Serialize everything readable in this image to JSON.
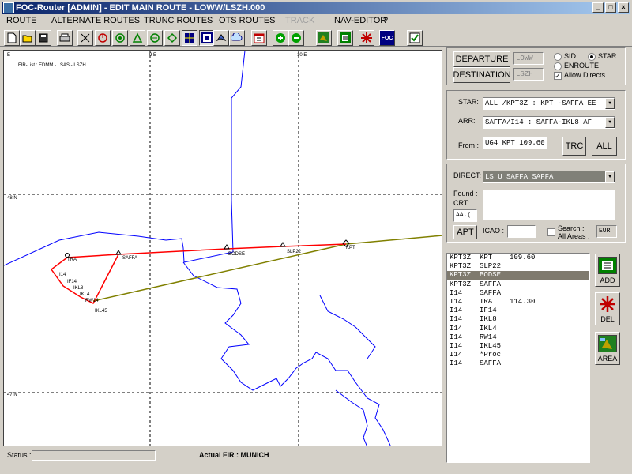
{
  "window": {
    "title": "FOC-Router [ADMIN] - EDIT MAIN ROUTE - LOWW/LSZH.000",
    "controls": [
      "_",
      "□",
      "×"
    ]
  },
  "menu": [
    "ROUTE",
    "ALTERNATE ROUTES",
    "TRUNC ROUTES",
    "OTS ROUTES",
    "TRACK",
    "NAV-EDITOR",
    "?"
  ],
  "toolbar": {
    "icons": [
      "new-icon",
      "open-icon",
      "save-icon",
      "print-icon",
      "measure-icon",
      "compass-icon",
      "target-icon",
      "triangle-icon",
      "navaid-icon",
      "navaid2-icon",
      "grid-icon",
      "zoom-box-icon",
      "plane-icon",
      "cloud-icon",
      "calendar-icon",
      "zoom-in-icon",
      "zoom-out-icon",
      "globe-icon",
      "save-route-icon",
      "redstar-icon",
      "foc-icon",
      "check-icon"
    ],
    "foc_label": "FOC"
  },
  "map": {
    "fir_list": "FIR-List : EDMM - LSAS - LSZH",
    "grid_labels": [
      "E",
      "9 E",
      "10 E",
      "48 N",
      "47 N"
    ],
    "waypoints": [
      "TRA",
      "SAFFA",
      "BODSE",
      "SLP22",
      "KPT",
      "I14",
      "IF14",
      "IKL8",
      "IKL4",
      "IKL45",
      "RW14"
    ],
    "colors": {
      "route": "#ff0000",
      "direct": "#808000",
      "border": "#0000ff",
      "grid": "#000000"
    }
  },
  "status": {
    "label": "Status :",
    "value": "",
    "actual_fir": "Actual FIR : MUNICH"
  },
  "right_panel": {
    "departure_btn": "DEPARTURE",
    "destination_btn": "DESTINATION",
    "departure_value": "LOWW",
    "destination_value": "LSZH",
    "sid_label": "SID",
    "star_label": "STAR",
    "enroute_label": "ENROUTE",
    "allow_directs_label": "Allow Directs",
    "star_field_label": "STAR:",
    "star_value": "ALL  /KPT3Z : KPT  -SAFFA EE",
    "arr_label": "ARR:",
    "arr_value": "SAFFA/I14   : SAFFA-IKL8  AF",
    "from_label": "From :",
    "from_value": "UG4  KPT  109.60",
    "trc_btn": "TRC",
    "all_btn": "ALL",
    "direct_label": "DIRECT:",
    "direct_value": "LS U   SAFFA         SAFFA",
    "found_label": "Found :",
    "crt_label": "CRT:",
    "crt_value": "AA.(",
    "apt_btn": "APT",
    "icao_label": "ICAO :",
    "icao_value": "",
    "search_label": "Search :",
    "all_areas_label": "All Areas .",
    "eur_value": "EUR"
  },
  "route_list": [
    {
      "a": "KPT3Z",
      "b": "KPT",
      "c": "109.60",
      "sel": false
    },
    {
      "a": "KPT3Z",
      "b": "SLP22",
      "c": "",
      "sel": false
    },
    {
      "a": "KPT3Z",
      "b": "BODSE",
      "c": "",
      "sel": true
    },
    {
      "a": "KPT3Z",
      "b": "SAFFA",
      "c": "",
      "sel": false
    },
    {
      "a": "I14",
      "b": "SAFFA",
      "c": "",
      "sel": false
    },
    {
      "a": "I14",
      "b": "TRA",
      "c": "114.30",
      "sel": false
    },
    {
      "a": "I14",
      "b": "IF14",
      "c": "",
      "sel": false
    },
    {
      "a": "I14",
      "b": "IKL8",
      "c": "",
      "sel": false
    },
    {
      "a": "I14",
      "b": "IKL4",
      "c": "",
      "sel": false
    },
    {
      "a": "I14",
      "b": "RW14",
      "c": "",
      "sel": false
    },
    {
      "a": "I14",
      "b": "IKL45",
      "c": "",
      "sel": false
    },
    {
      "a": "I14",
      "b": "*Proc",
      "c": "",
      "sel": false
    },
    {
      "a": "I14",
      "b": "SAFFA",
      "c": "",
      "sel": false
    }
  ],
  "side_buttons": {
    "add": "ADD",
    "del": "DEL",
    "area": "AREA"
  }
}
